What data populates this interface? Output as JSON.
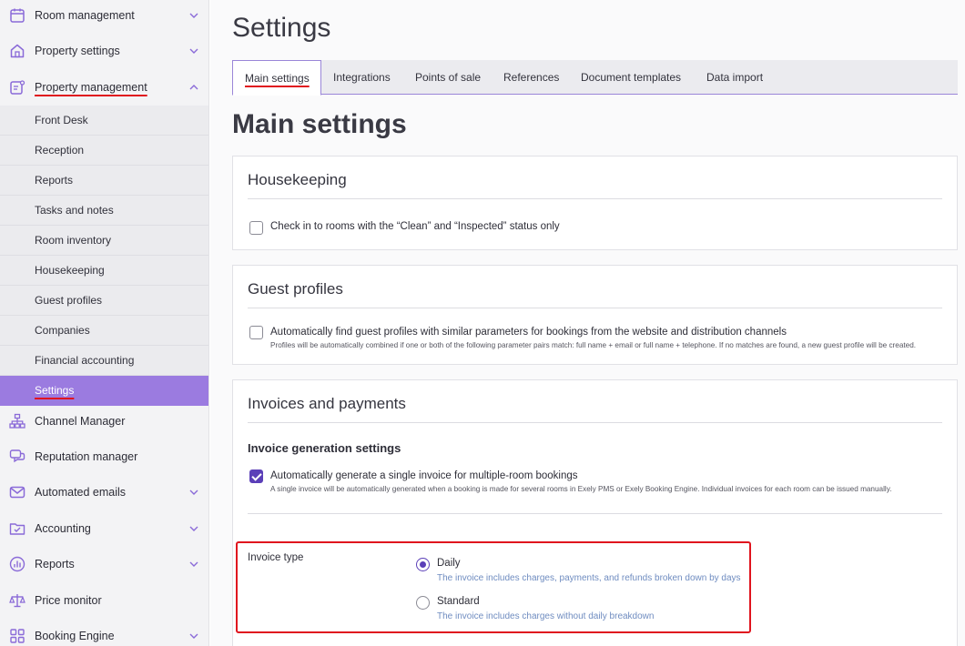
{
  "sidebar": {
    "top_items": [
      {
        "label": "Room management",
        "icon": "calendar-icon"
      },
      {
        "label": "Property settings",
        "icon": "house-icon"
      },
      {
        "label": "Property management",
        "icon": "clipboard-icon"
      }
    ],
    "sub_items": [
      "Front Desk",
      "Reception",
      "Reports",
      "Tasks and notes",
      "Room inventory",
      "Housekeeping",
      "Guest profiles",
      "Companies",
      "Financial accounting",
      "Settings"
    ],
    "bottom_items": [
      {
        "label": "Channel Manager",
        "icon": "network-icon"
      },
      {
        "label": "Reputation manager",
        "icon": "chat-icon"
      },
      {
        "label": "Automated emails",
        "icon": "envelope-icon"
      },
      {
        "label": "Accounting",
        "icon": "folder-check-icon"
      },
      {
        "label": "Reports",
        "icon": "chart-icon"
      },
      {
        "label": "Price monitor",
        "icon": "scales-icon"
      },
      {
        "label": "Booking Engine",
        "icon": "grid-icon"
      }
    ]
  },
  "header": {
    "title": "Settings"
  },
  "tabs": [
    "Main settings",
    "Integrations",
    "Points of sale",
    "References",
    "Document templates",
    "Data import"
  ],
  "main": {
    "title": "Main settings",
    "housekeeping": {
      "title": "Housekeeping",
      "checkbox_label": "Check in to rooms with the “Clean” and “Inspected” status only"
    },
    "guest_profiles": {
      "title": "Guest profiles",
      "checkbox_label": "Automatically find guest profiles with similar parameters for bookings from the website and distribution channels",
      "hint": "Profiles will be automatically combined if one or both of the following parameter pairs match: full name + email or full name + telephone. If no matches are found, a new guest profile will be created."
    },
    "invoices": {
      "title": "Invoices and payments",
      "subheading": "Invoice generation settings",
      "checkbox_label": "Automatically generate a single invoice for multiple-room bookings",
      "hint": "A single invoice will be automatically generated when a booking is made for several rooms in Exely PMS or Exely Booking Engine. Individual invoices for each room can be issued manually.",
      "invoice_type_label": "Invoice type",
      "options": [
        {
          "label": "Daily",
          "hint": "The invoice includes charges, payments, and refunds broken down by days"
        },
        {
          "label": "Standard",
          "hint": "The invoice includes charges without daily breakdown"
        }
      ]
    }
  },
  "colors": {
    "accent": "#9b7be0",
    "accent_dark": "#5b3fb8",
    "annotation_red": "#e0141e",
    "hint_blue": "#6f8cc0"
  }
}
